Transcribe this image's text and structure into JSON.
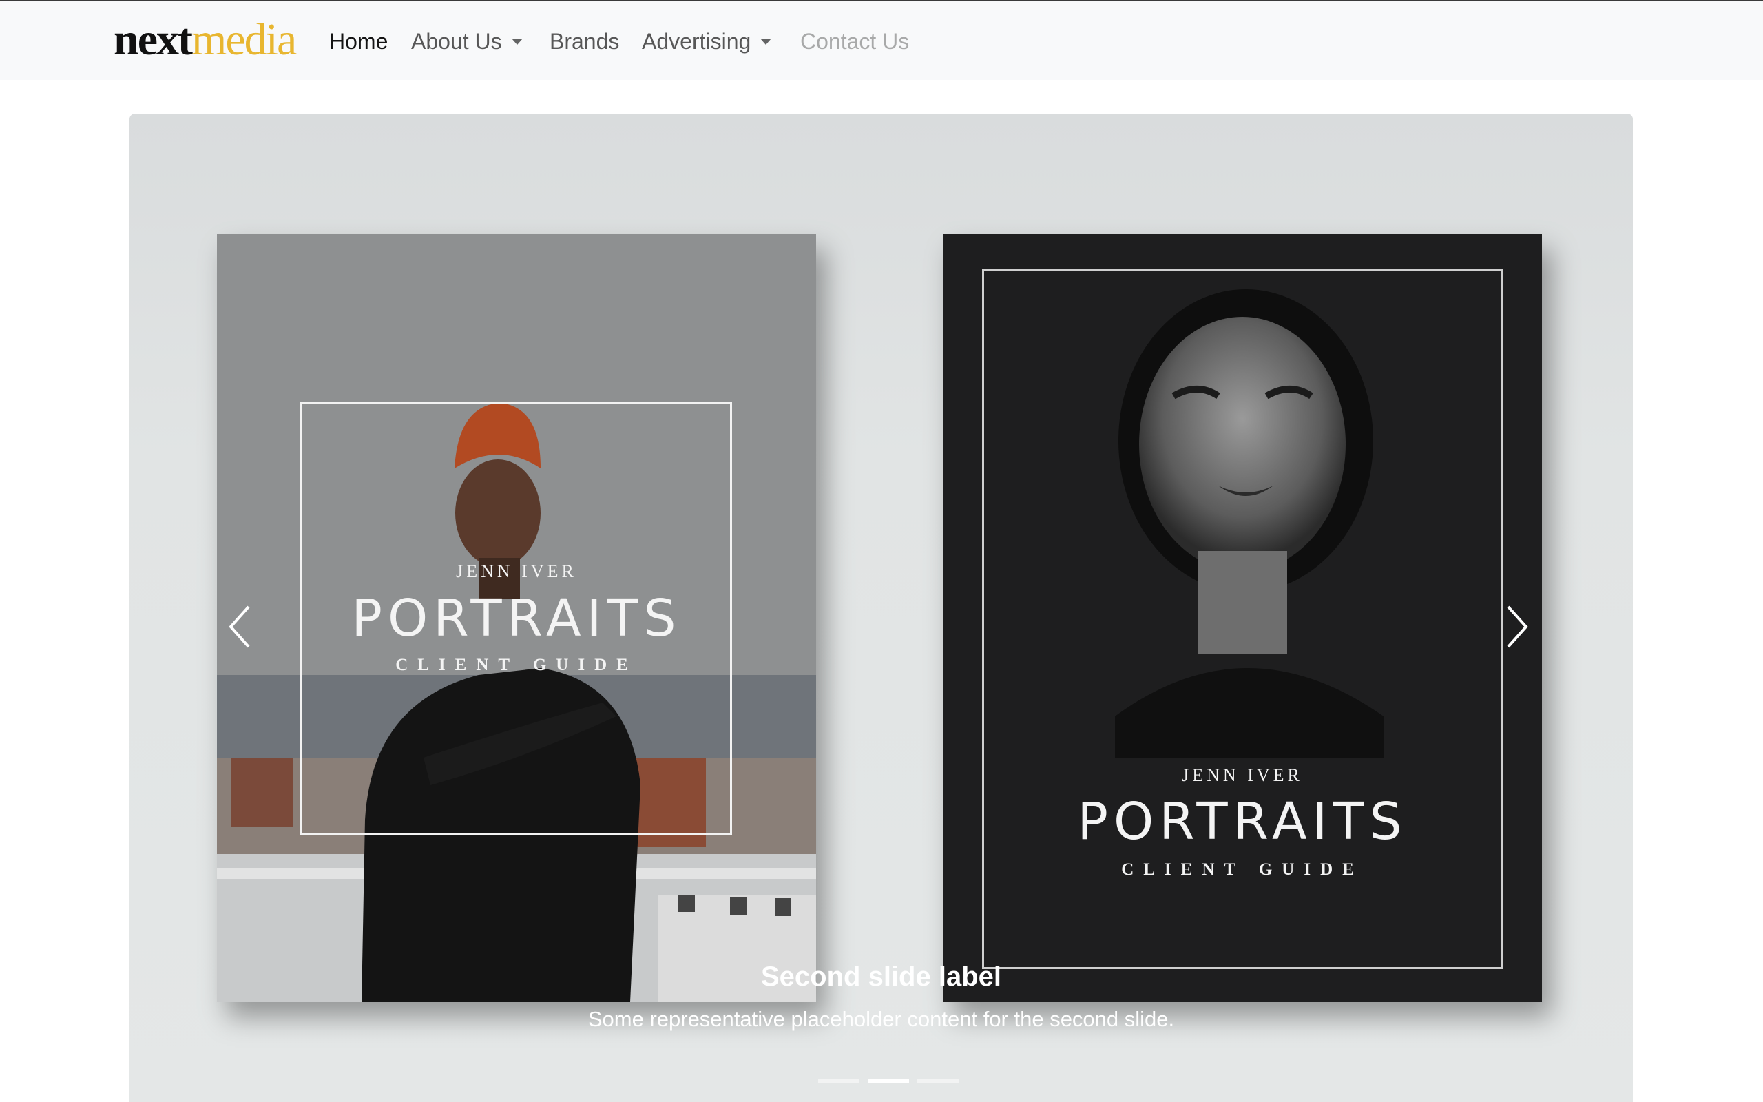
{
  "nav": {
    "brand_part1": "next",
    "brand_part2": "media",
    "links": [
      {
        "label": "Home",
        "state": "active"
      },
      {
        "label": "About Us",
        "dropdown": true
      },
      {
        "label": "Brands"
      },
      {
        "label": "Advertising",
        "dropdown": true
      },
      {
        "label": "Contact Us",
        "state": "disabled"
      }
    ]
  },
  "carousel": {
    "left_cover": {
      "author": "JENN IVER",
      "title": "PORTRAITS",
      "subtitle": "CLIENT GUIDE"
    },
    "right_cover": {
      "author": "JENN IVER",
      "title": "PORTRAITS",
      "subtitle": "CLIENT GUIDE"
    },
    "caption_title": "Second slide label",
    "caption_text": "Some representative placeholder content for the second slide.",
    "active_slide": 2,
    "slide_count": 3
  },
  "colors": {
    "brand_accent": "#e8b62f",
    "navbar_bg": "#f8f9fa",
    "dark_cover": "#1e1e1f"
  },
  "icons": {
    "prev": "chevron-left-icon",
    "next": "chevron-right-icon"
  }
}
